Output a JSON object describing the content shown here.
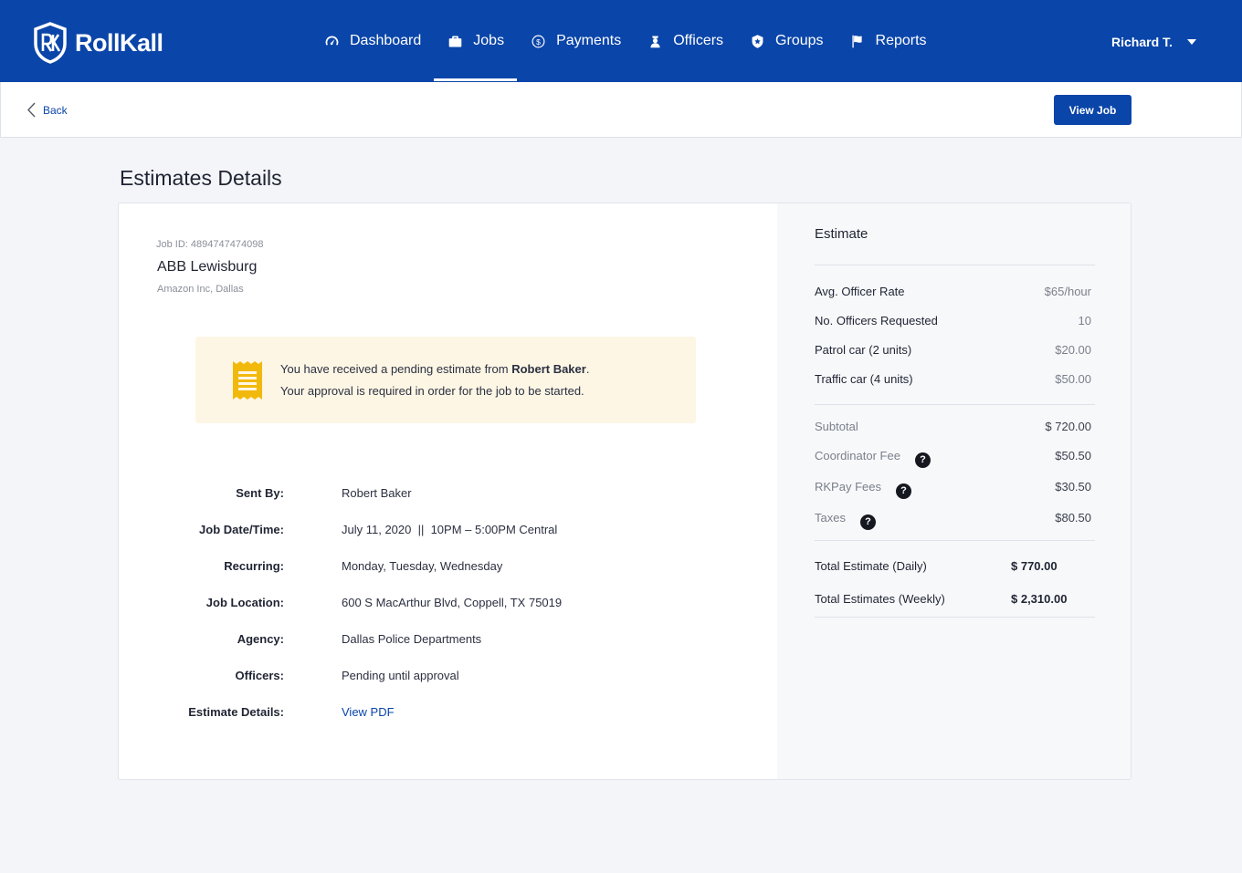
{
  "brand": {
    "name": "RollKall"
  },
  "nav": {
    "items": [
      {
        "label": "Dashboard",
        "icon": "speedometer-icon"
      },
      {
        "label": "Jobs",
        "icon": "briefcase-icon",
        "active": true
      },
      {
        "label": "Payments",
        "icon": "dollar-circle-icon"
      },
      {
        "label": "Officers",
        "icon": "officer-icon"
      },
      {
        "label": "Groups",
        "icon": "shield-icon"
      },
      {
        "label": "Reports",
        "icon": "flag-icon"
      }
    ],
    "user": "Richard T."
  },
  "subheader": {
    "back_label": "Back",
    "view_job_label": "View Job"
  },
  "page": {
    "title": "Estimates Details"
  },
  "job": {
    "id_text": "Job ID: 4894747474098",
    "name": "ABB Lewisburg",
    "company": "Amazon Inc, Dallas"
  },
  "notice": {
    "prefix": "You have received a pending estimate from ",
    "sender": "Robert Baker",
    "suffix": ".",
    "line2": "Your approval is required in order for the job to be started."
  },
  "details": [
    {
      "label": "Sent By:",
      "value": "Robert Baker"
    },
    {
      "label": "Job Date/Time:",
      "value": "July 11, 2020  ||  10PM – 5:00PM Central"
    },
    {
      "label": "Recurring:",
      "value": "Monday, Tuesday, Wednesday"
    },
    {
      "label": "Job Location:",
      "value": "600 S MacArthur Blvd, Coppell, TX 75019"
    },
    {
      "label": "Agency:",
      "value": "Dallas Police Departments"
    },
    {
      "label": "Officers:",
      "value": "Pending until approval"
    },
    {
      "label": "Estimate Details:",
      "value": "View PDF"
    }
  ],
  "estimate": {
    "title": "Estimate",
    "lines": [
      {
        "label": "Avg. Officer Rate",
        "value": "$65/hour"
      },
      {
        "label": "No. Officers Requested",
        "value": "10"
      },
      {
        "label": "Patrol car (2 units)",
        "value": "$20.00"
      },
      {
        "label": "Traffic car (4 units)",
        "value": "$50.00"
      }
    ],
    "fees": [
      {
        "label": "Subtotal",
        "value": "$ 720.00"
      },
      {
        "label": "Coordinator Fee",
        "value": "$50.50"
      },
      {
        "label": "RKPay Fees",
        "value": "$30.50"
      },
      {
        "label": "Taxes",
        "value": "$80.50"
      }
    ],
    "help_glyph": "?",
    "totals": [
      {
        "label": "Total Estimate (Daily)",
        "value": "$ 770.00"
      },
      {
        "label": "Total Estimates (Weekly)",
        "value": "$ 2,310.00"
      }
    ]
  },
  "colors": {
    "primary": "#0a45a9",
    "notice_bg": "#fdf6e5",
    "receipt": "#f2b90d"
  }
}
